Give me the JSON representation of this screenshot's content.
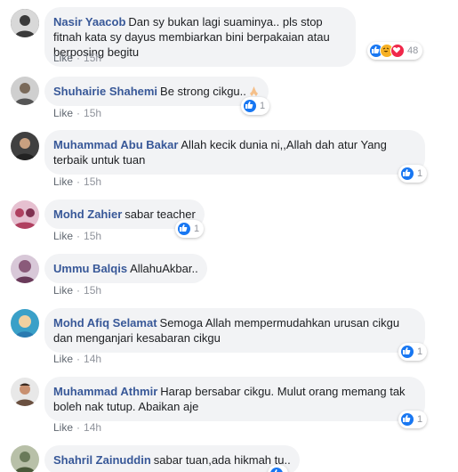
{
  "comments": [
    {
      "author": "Nasir Yaacob",
      "text": "Dan sy bukan lagi suaminya.. pls stop fitnah kata sy dayus membiarkan bini berpakaian atau berposing begitu",
      "like_label": "Like",
      "time": "15h",
      "reaction_count": "48",
      "avatar_color": "#3a3a3a"
    },
    {
      "author": "Shuhairie Shahemi",
      "text": "Be strong cikgu..",
      "like_label": "Like",
      "time": "15h",
      "reaction_count": "1",
      "avatar_color": "#7a6a5a"
    },
    {
      "author": "Muhammad Abu Bakar",
      "text": "Allah kecik dunia ni,,Allah dah atur Yang terbaik untuk tuan",
      "like_label": "Like",
      "time": "15h",
      "reaction_count": "1",
      "avatar_color": "#222222"
    },
    {
      "author": "Mohd Zahier",
      "text": "sabar teacher",
      "like_label": "Like",
      "time": "15h",
      "reaction_count": "1",
      "avatar_color": "#b04060"
    },
    {
      "author": "Ummu Balqis",
      "text": "AllahuAkbar..",
      "like_label": "Like",
      "time": "15h",
      "reaction_count": "",
      "avatar_color": "#8a5a7a"
    },
    {
      "author": "Mohd Afiq Selamat",
      "text": "Semoga Allah mempermudahkan urusan cikgu dan menganjari kesabaran cikgu",
      "like_label": "Like",
      "time": "14h",
      "reaction_count": "1",
      "avatar_color": "#3aa0c8"
    },
    {
      "author": "Muhammad Athmir",
      "text": "Harap bersabar cikgu. Mulut orang memang tak boleh nak tutup. Abaikan aje",
      "like_label": "Like",
      "time": "14h",
      "reaction_count": "1",
      "avatar_color": "#6a5040"
    },
    {
      "author": "Shahril Zainuddin",
      "text": "sabar tuan,ada hikmah tu..",
      "like_label": "",
      "time": "",
      "reaction_count": "",
      "avatar_color": "#6a7a5a"
    }
  ],
  "colors": {
    "author_link": "#385898",
    "bubble_bg": "#f2f3f5",
    "like_blue": "#1877f2",
    "meta_gray": "#90949c"
  }
}
